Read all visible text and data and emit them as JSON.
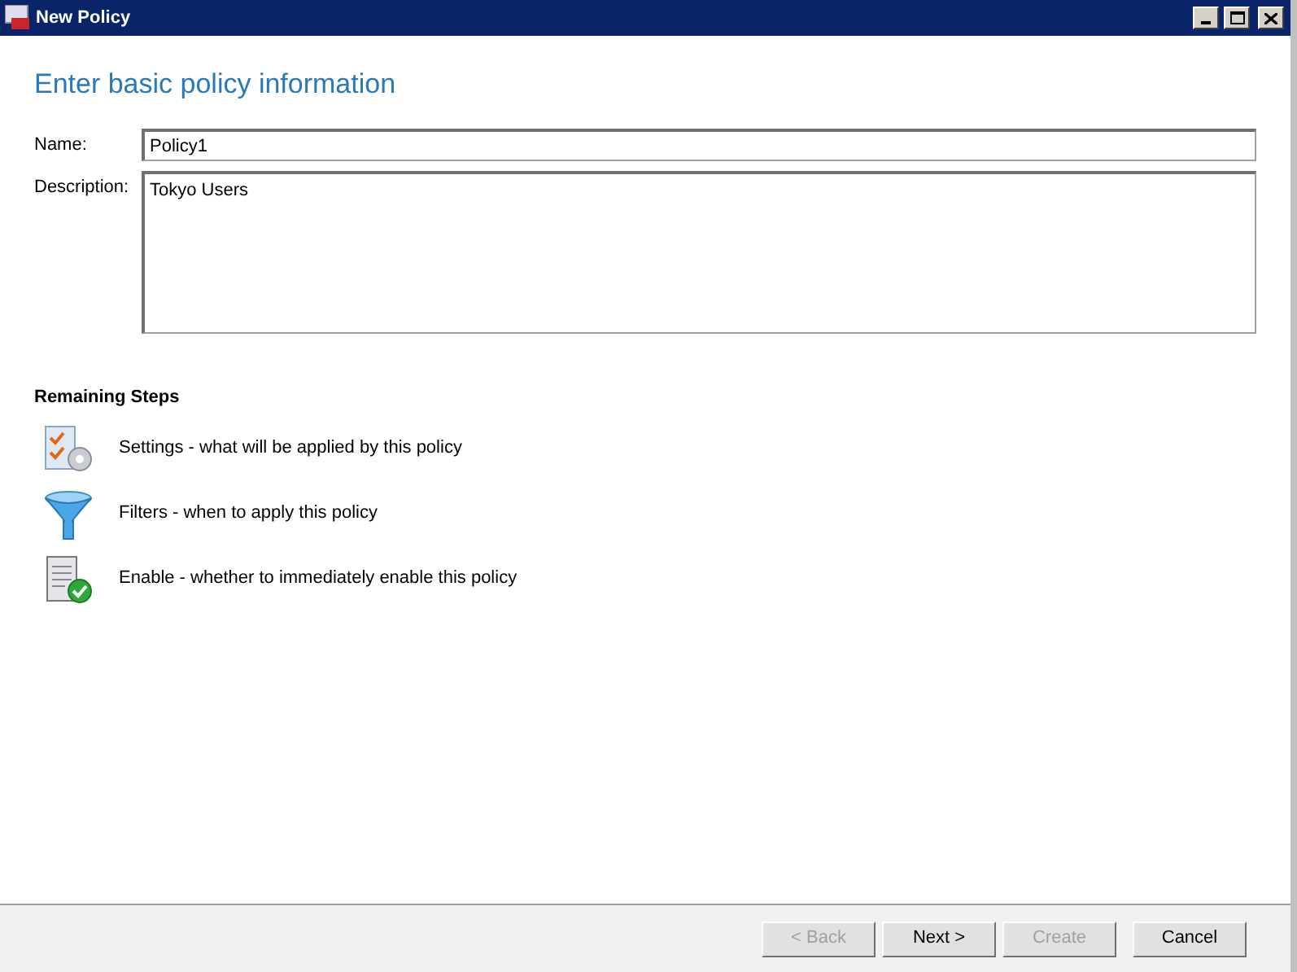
{
  "window": {
    "title": "New Policy"
  },
  "heading": "Enter basic policy information",
  "fields": [
    {
      "label": "Name:",
      "value": "Policy1",
      "kind": "line"
    },
    {
      "label": "Description:",
      "value": "Tokyo Users",
      "kind": "area"
    }
  ],
  "remaining_steps": {
    "title": "Remaining Steps",
    "steps": [
      {
        "kind": "settings",
        "text": "Settings - what will be applied by this policy"
      },
      {
        "kind": "filters",
        "text": "Filters - when to apply this policy"
      },
      {
        "kind": "enable",
        "text": "Enable - whether to immediately enable this policy"
      }
    ]
  },
  "buttons": [
    {
      "label": "< Back",
      "disabled": true
    },
    {
      "label": "Next >",
      "disabled": false
    },
    {
      "label": "Create",
      "disabled": true
    },
    {
      "label": "Cancel",
      "disabled": false
    }
  ]
}
